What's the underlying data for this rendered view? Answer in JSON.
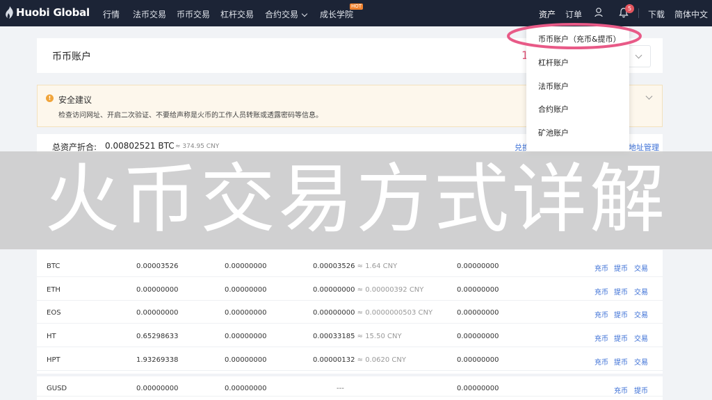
{
  "nav": {
    "logo": "Huobi Global",
    "items": [
      "行情",
      "法币交易",
      "币币交易",
      "杠杆交易",
      "合约交易",
      "成长学院"
    ],
    "hot_badge": "HOT",
    "assets": "资产",
    "orders": "订单",
    "notification_count": "5",
    "download": "下载",
    "language": "简体中文"
  },
  "account": {
    "title": "币币账户",
    "step_marker": "1"
  },
  "notice": {
    "title": "安全建议",
    "text": "检查访问网址、开启二次验证、不要给声称是火币的工作人员转账或透露密码等信息。"
  },
  "total": {
    "label": "总资产折合:",
    "btc": "0.00802521 BTC",
    "cny": "≈ 374.95 CNY",
    "link_exchange": "兑换",
    "link_manage": "地址管理"
  },
  "dropdown": {
    "items": [
      "币币账户（充币&提币）",
      "杠杆账户",
      "法币账户",
      "合约账户",
      "矿池账户"
    ],
    "highlight_color": "#e85a87"
  },
  "table": {
    "rows": [
      {
        "coin": "BTC",
        "v1": "0.00003526",
        "v2": "0.00000000",
        "v3": "0.00003526",
        "v3_cny": "≈ 1.64 CNY",
        "v4": "0.00000000",
        "actions": [
          "充币",
          "提币",
          "交易"
        ]
      },
      {
        "coin": "ETH",
        "v1": "0.00000000",
        "v2": "0.00000000",
        "v3": "0.00000000",
        "v3_cny": "≈ 0.00000392 CNY",
        "v4": "0.00000000",
        "actions": [
          "充币",
          "提币",
          "交易"
        ]
      },
      {
        "coin": "EOS",
        "v1": "0.00000000",
        "v2": "0.00000000",
        "v3": "0.00000000",
        "v3_cny": "≈ 0.0000000503 CNY",
        "v4": "0.00000000",
        "actions": [
          "充币",
          "提币",
          "交易"
        ]
      },
      {
        "coin": "HT",
        "v1": "0.65298633",
        "v2": "0.00000000",
        "v3": "0.00033185",
        "v3_cny": "≈ 15.50 CNY",
        "v4": "0.00000000",
        "actions": [
          "充币",
          "提币",
          "交易"
        ]
      },
      {
        "coin": "HPT",
        "v1": "1.93269338",
        "v2": "0.00000000",
        "v3": "0.00000132",
        "v3_cny": "≈ 0.0620 CNY",
        "v4": "0.00000000",
        "actions": [
          "充币",
          "提币",
          "交易"
        ]
      },
      {
        "coin": "GUSD",
        "v1": "0.00000000",
        "v2": "0.00000000",
        "v3": "---",
        "v3_cny": "",
        "v4": "0.00000000",
        "actions": [
          "充币",
          "提币"
        ]
      }
    ]
  },
  "banner": {
    "text": "火币交易方式详解"
  }
}
